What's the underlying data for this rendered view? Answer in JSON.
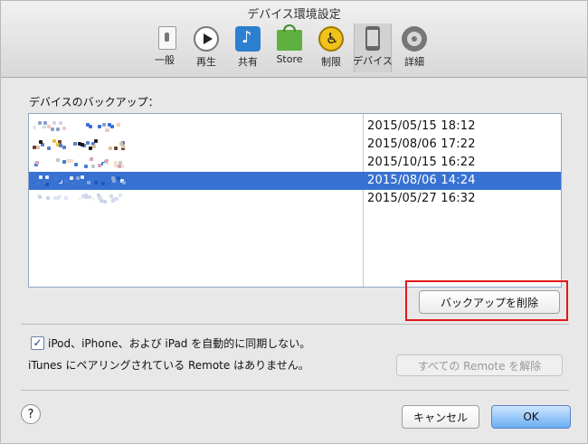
{
  "window": {
    "title": "デバイス環境設定"
  },
  "toolbar": {
    "items": [
      {
        "label": "一般",
        "icon": "general-icon"
      },
      {
        "label": "再生",
        "icon": "play-icon"
      },
      {
        "label": "共有",
        "icon": "share-icon"
      },
      {
        "label": "Store",
        "icon": "store-icon"
      },
      {
        "label": "制限",
        "icon": "restriction-icon"
      },
      {
        "label": "デバイス",
        "icon": "device-icon",
        "active": true
      },
      {
        "label": "詳細",
        "icon": "advanced-icon"
      }
    ]
  },
  "backups": {
    "label": "デバイスのバックアップ：",
    "rows": [
      {
        "date": "2015/05/15 18:12"
      },
      {
        "date": "2015/08/06 17:22"
      },
      {
        "date": "2015/10/15 16:22"
      },
      {
        "date": "2015/08/06 14:24",
        "selected": true
      },
      {
        "date": "2015/05/27 16:32"
      }
    ],
    "delete_button": "バックアップを削除"
  },
  "sync": {
    "checkbox_label": "iPod、iPhone、および iPad を自動的に同期しない。",
    "checked": true
  },
  "remote": {
    "text": "iTunes にペアリングされている Remote はありません。",
    "button": "すべての Remote を解除"
  },
  "footer": {
    "help_label": "?",
    "cancel": "キャンセル",
    "ok": "OK"
  },
  "colors": {
    "selection": "#3771d2",
    "highlight": "#e2181a",
    "ok_button": "#69aef3"
  }
}
